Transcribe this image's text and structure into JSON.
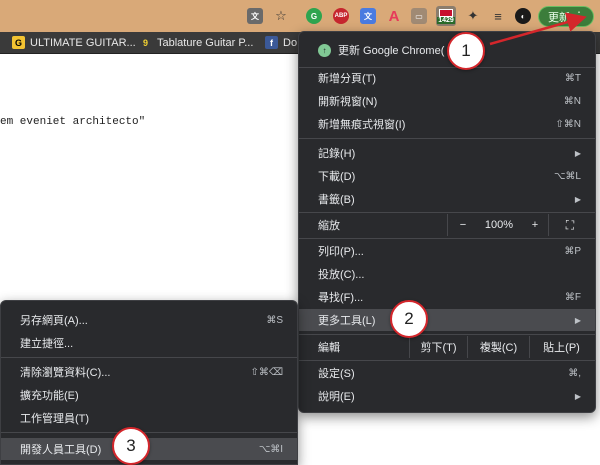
{
  "toolbar": {
    "update_label": "更新",
    "menu_dots": "⋮",
    "ext_badge_count": "1429",
    "ext_abp": "ABP"
  },
  "bookmarks": [
    {
      "label": "ULTIMATE GUITAR...",
      "fav": "G"
    },
    {
      "label": "Tablature Guitar P...",
      "fav": "9"
    },
    {
      "label": "Do",
      "fav": "f"
    }
  ],
  "page": {
    "text": "em eveniet architecto\""
  },
  "chrome_menu": {
    "update_item": "更新 Google Chrome(",
    "new_tab": {
      "label": "新增分頁(T)",
      "shortcut": "⌘T"
    },
    "new_window": {
      "label": "開新視窗(N)",
      "shortcut": "⌘N"
    },
    "incognito": {
      "label": "新增無痕式視窗(I)",
      "shortcut": "⇧⌘N"
    },
    "history": {
      "label": "記錄(H)"
    },
    "downloads": {
      "label": "下載(D)",
      "shortcut": "⌥⌘L"
    },
    "bookmarks": {
      "label": "書籤(B)"
    },
    "zoom": {
      "label": "縮放",
      "minus": "−",
      "percent": "100%",
      "plus": "+"
    },
    "print": {
      "label": "列印(P)...",
      "shortcut": "⌘P"
    },
    "cast": {
      "label": "投放(C)..."
    },
    "find": {
      "label": "尋找(F)...",
      "shortcut": "⌘F"
    },
    "more_tools": {
      "label": "更多工具(L)"
    },
    "edit": {
      "label": "編輯",
      "cut": "剪下(T)",
      "copy": "複製(C)",
      "paste": "貼上(P)"
    },
    "settings": {
      "label": "設定(S)",
      "shortcut": "⌘,"
    },
    "help": {
      "label": "說明(E)"
    }
  },
  "tools_menu": {
    "save_page": {
      "label": "另存網頁(A)...",
      "shortcut": "⌘S"
    },
    "create_shortcut": {
      "label": "建立捷徑..."
    },
    "clear_data": {
      "label": "清除瀏覽資料(C)...",
      "shortcut": "⇧⌘⌫"
    },
    "extensions": {
      "label": "擴充功能(E)"
    },
    "task_manager": {
      "label": "工作管理員(T)"
    },
    "dev_tools": {
      "label": "開發人員工具(D)",
      "shortcut": "⌥⌘I"
    }
  },
  "annotations": {
    "step1": "1",
    "step2": "2",
    "step3": "3",
    "arrow_color": "#d4262b"
  }
}
